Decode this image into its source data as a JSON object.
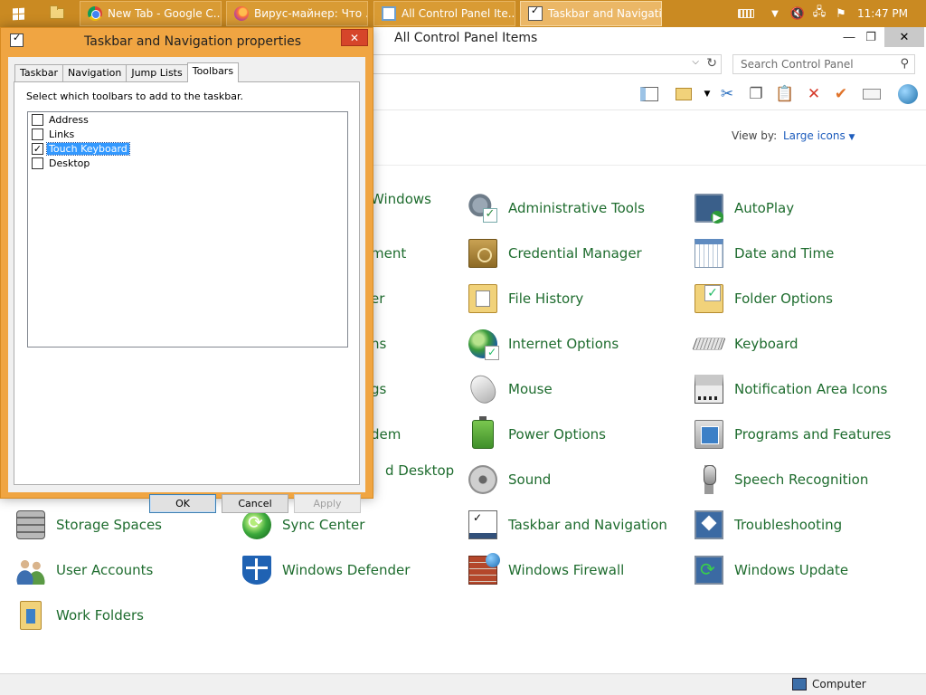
{
  "taskbar": {
    "tasks": [
      {
        "label": "New Tab - Google C..."
      },
      {
        "label": "Вирус-майнер: Что ..."
      },
      {
        "label": "All Control Panel Ite..."
      },
      {
        "label": "Taskbar and Navigati..."
      }
    ],
    "clock": "11:47 PM",
    "accent": "#ca8a22"
  },
  "window": {
    "title": "All Control Panel Items",
    "search_placeholder": "Search Control Panel",
    "view_by_label": "View by:",
    "view_by_value": "Large icons",
    "items": [
      {
        "label": "Windows",
        "icon": "windows-partial-icon"
      },
      {
        "label": "Administrative Tools",
        "icon": "admin-tools-icon"
      },
      {
        "label": "AutoPlay",
        "icon": "autoplay-icon"
      },
      {
        "label": "ment",
        "icon": "partial"
      },
      {
        "label": "Credential Manager",
        "icon": "credential-manager-icon"
      },
      {
        "label": "Date and Time",
        "icon": "date-time-icon"
      },
      {
        "label": "er",
        "icon": "partial"
      },
      {
        "label": "File History",
        "icon": "file-history-icon"
      },
      {
        "label": "Folder Options",
        "icon": "folder-options-icon"
      },
      {
        "label": "ns",
        "icon": "partial"
      },
      {
        "label": "Internet Options",
        "icon": "internet-options-icon"
      },
      {
        "label": "Keyboard",
        "icon": "keyboard-icon"
      },
      {
        "label": "gs",
        "icon": "partial"
      },
      {
        "label": "Mouse",
        "icon": "mouse-icon"
      },
      {
        "label": "Notification Area Icons",
        "icon": "notification-area-icon"
      },
      {
        "label": "dem",
        "icon": "partial"
      },
      {
        "label": "Power Options",
        "icon": "power-options-icon"
      },
      {
        "label": "Programs and Features",
        "icon": "programs-features-icon"
      },
      {
        "label": "d Desktop",
        "icon": "partial"
      },
      {
        "label": "Sound",
        "icon": "sound-icon"
      },
      {
        "label": "Speech Recognition",
        "icon": "speech-recognition-icon"
      },
      {
        "label": "Storage Spaces",
        "icon": "storage-spaces-icon"
      },
      {
        "label": "Sync Center",
        "icon": "sync-center-icon"
      },
      {
        "label": "Taskbar and Navigation",
        "icon": "taskbar-navigation-icon"
      },
      {
        "label": "Troubleshooting",
        "icon": "troubleshooting-icon"
      },
      {
        "label": "User Accounts",
        "icon": "user-accounts-icon"
      },
      {
        "label": "Windows Defender",
        "icon": "windows-defender-icon"
      },
      {
        "label": "Windows Firewall",
        "icon": "windows-firewall-icon"
      },
      {
        "label": "Windows Update",
        "icon": "windows-update-icon"
      },
      {
        "label": "Work Folders",
        "icon": "work-folders-icon"
      }
    ],
    "status": "Computer"
  },
  "dialog": {
    "title": "Taskbar and Navigation properties",
    "tabs": [
      "Taskbar",
      "Navigation",
      "Jump Lists",
      "Toolbars"
    ],
    "active_tab": "Toolbars",
    "instruction": "Select which toolbars to add to the taskbar.",
    "toolbars": [
      {
        "label": "Address",
        "checked": false
      },
      {
        "label": "Links",
        "checked": false
      },
      {
        "label": "Touch Keyboard",
        "checked": true
      },
      {
        "label": "Desktop",
        "checked": false
      }
    ],
    "buttons": {
      "ok": "OK",
      "cancel": "Cancel",
      "apply": "Apply"
    }
  }
}
